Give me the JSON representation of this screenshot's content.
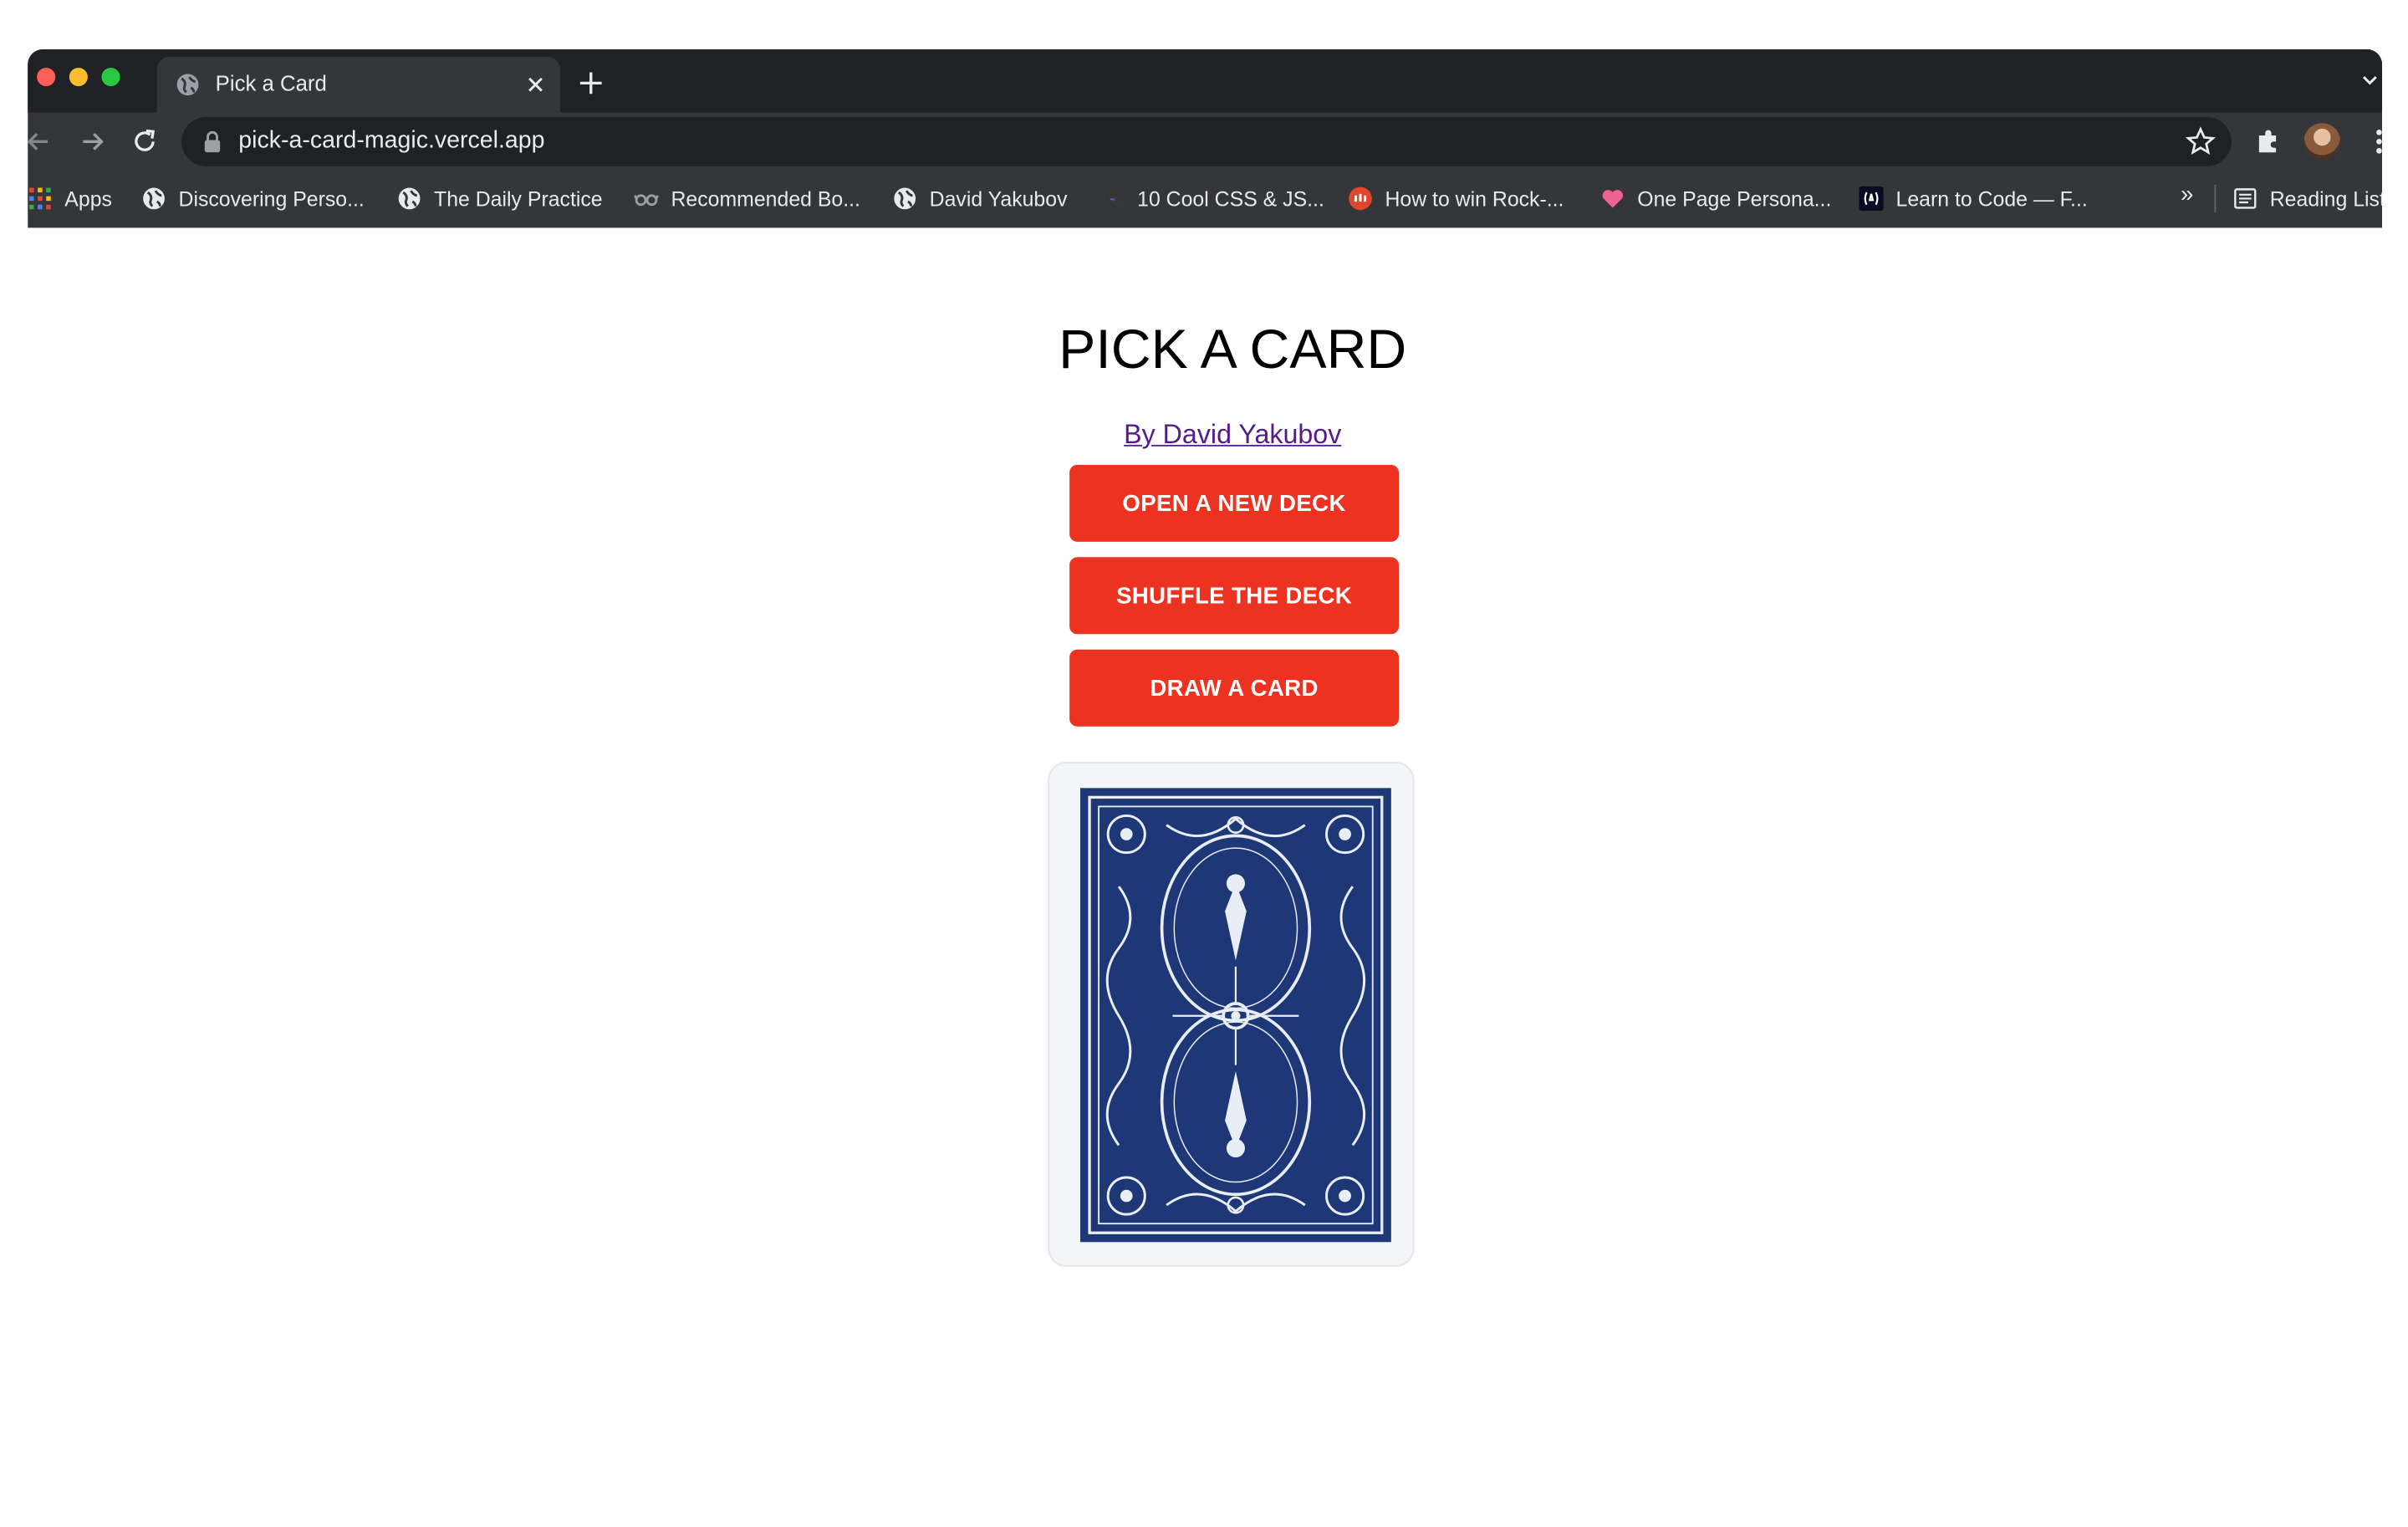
{
  "browser": {
    "tab": {
      "title": "Pick a Card"
    },
    "address_bar": {
      "url": "pick-a-card-magic.vercel.app"
    },
    "bookmarks": [
      {
        "label": "Apps",
        "icon": "apps-grid-icon"
      },
      {
        "label": "Discovering Perso...",
        "icon": "globe-icon"
      },
      {
        "label": "The Daily Practice",
        "icon": "globe-icon"
      },
      {
        "label": "Recommended Bo...",
        "icon": "glasses-icon"
      },
      {
        "label": "David Yakubov",
        "icon": "globe-icon"
      },
      {
        "label": "10 Cool CSS & JS...",
        "icon": "bolt-icon"
      },
      {
        "label": "How to win Rock-...",
        "icon": "red-circle-icon"
      },
      {
        "label": "One Page Persona...",
        "icon": "heart-icon"
      },
      {
        "label": "Learn to Code — F...",
        "icon": "freecodecamp-icon"
      }
    ],
    "bookmarks_overflow": "»",
    "reading_list": {
      "label": "Reading List",
      "icon": "reading-list-icon"
    }
  },
  "page": {
    "title": "PICK A CARD",
    "byline": "By David Yakubov",
    "buttons": {
      "open_deck": "OPEN A NEW DECK",
      "shuffle": "SHUFFLE THE DECK",
      "draw": "DRAW A CARD"
    },
    "card": {
      "state": "face-down",
      "icon": "card-back-icon"
    }
  },
  "colors": {
    "button": "#ec3322",
    "card_back": "#1d3777",
    "link": "#551a8b",
    "chrome_dark": "#202124",
    "chrome_toolbar": "#35363a"
  }
}
